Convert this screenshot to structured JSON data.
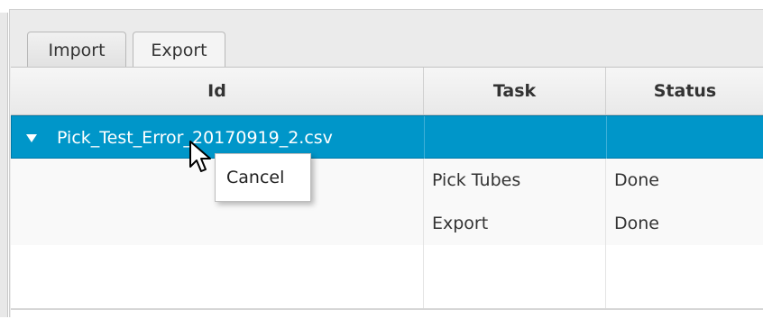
{
  "tabs": [
    {
      "label": "Import",
      "selected": false
    },
    {
      "label": "Export",
      "selected": true
    }
  ],
  "table": {
    "columns": [
      "Id",
      "Task",
      "Status"
    ],
    "rows": [
      {
        "id": "Pick_Test_Error_20170919_2.csv",
        "task": "",
        "status": "",
        "selected": true,
        "expanded": true
      },
      {
        "id": "",
        "task": "Pick Tubes",
        "status": "Done"
      },
      {
        "id": "",
        "task": "Export",
        "status": "Done"
      },
      {
        "id": "",
        "task": "",
        "status": ""
      }
    ]
  },
  "context_menu": {
    "items": [
      "Cancel"
    ]
  },
  "colors": {
    "selection": "#0096c9",
    "header_bg": "#efefef"
  },
  "icons": {
    "disclosure": "triangle-down-icon",
    "cursor": "mouse-pointer-icon"
  }
}
